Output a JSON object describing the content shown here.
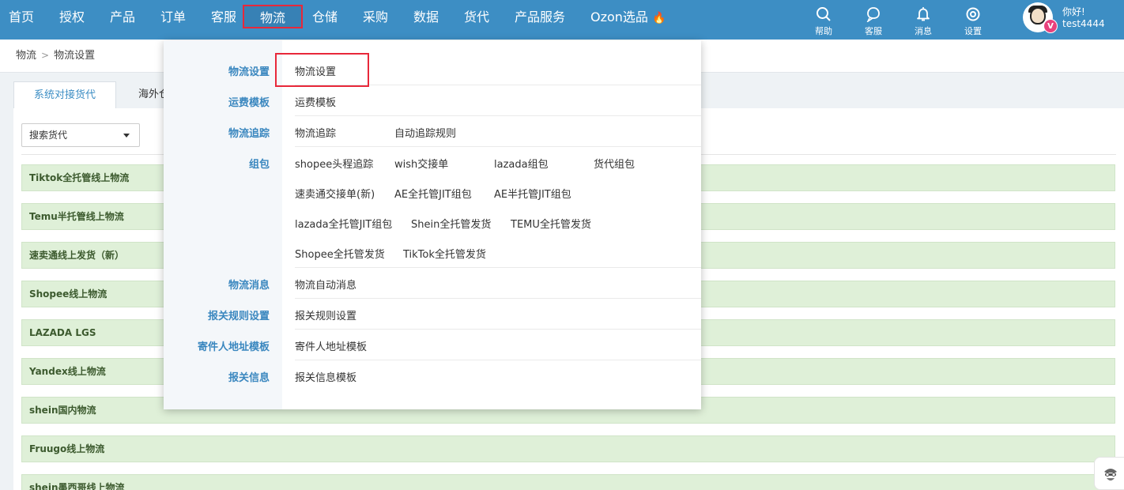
{
  "nav": {
    "items": [
      "首页",
      "授权",
      "产品",
      "订单",
      "客服",
      "物流",
      "仓储",
      "采购",
      "数据",
      "货代",
      "产品服务",
      "Ozon选品"
    ],
    "active_index": 5
  },
  "tools": {
    "help": "帮助",
    "service": "客服",
    "message": "消息",
    "settings": "设置"
  },
  "user": {
    "greeting": "你好!",
    "name": "test4444",
    "badge": "V"
  },
  "breadcrumb": {
    "root": "物流",
    "current": "物流设置"
  },
  "tabs": [
    "系统对接货代",
    "海外仓"
  ],
  "filter": {
    "placeholder": "搜索货代"
  },
  "groups": [
    "Tiktok全托管线上物流",
    "Temu半托管线上物流",
    "速卖通线上发货（新）",
    "Shopee线上物流",
    "LAZADA LGS",
    "Yandex线上物流",
    "shein国内物流",
    "Fruugo线上物流",
    "shein墨西哥线上物流"
  ],
  "dropdown": {
    "categories": {
      "logistics_settings": "物流设置",
      "freight_template": "运费模板",
      "tracking": "物流追踪",
      "packaging": "组包",
      "logistics_message": "物流消息",
      "customs_rules": "报关规则设置",
      "sender_address": "寄件人地址模板",
      "customs_info": "报关信息"
    },
    "links": {
      "logistics_settings": "物流设置",
      "freight_template": "运费模板",
      "tracking": "物流追踪",
      "auto_tracking_rules": "自动追踪规则",
      "shopee_first_leg": "shopee头程追踪",
      "wish_handover": "wish交接单",
      "lazada_pack": "lazada组包",
      "forwarder_pack": "货代组包",
      "aliexpress_handover": "速卖通交接单(新)",
      "ae_full_jit": "AE全托管JIT组包",
      "ae_half_jit": "AE半托管JIT组包",
      "lazada_full_jit": "lazada全托管JIT组包",
      "shein_full_ship": "Shein全托管发货",
      "temu_full_ship": "TEMU全托管发货",
      "shopee_full_ship": "Shopee全托管发货",
      "tiktok_full_ship": "TikTok全托管发货",
      "auto_message": "物流自动消息",
      "customs_rules": "报关规则设置",
      "sender_address": "寄件人地址模板",
      "customs_info": "报关信息模板"
    }
  }
}
